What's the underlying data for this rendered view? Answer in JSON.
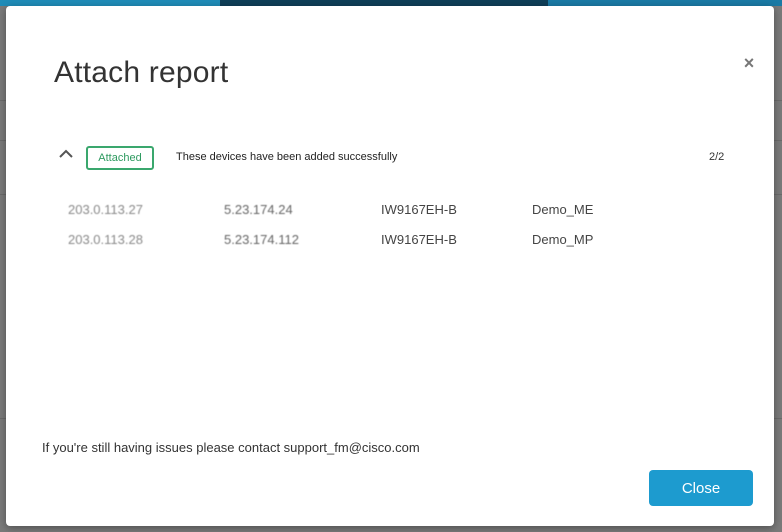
{
  "dialog": {
    "title": "Attach report",
    "close_symbol": "×",
    "status_badge": "Attached",
    "status_message": "These devices have been added successfully",
    "count": "2/2",
    "devices": [
      {
        "ip": "203.0.113.27",
        "address": "5.23.174.24",
        "model": "IW9167EH-B",
        "name": "Demo_ME"
      },
      {
        "ip": "203.0.113.28",
        "address": "5.23.174.112",
        "model": "IW9167EH-B",
        "name": "Demo_MP"
      }
    ],
    "footer_note": "If you're still having issues please contact support_fm@cisco.com",
    "close_button": "Close"
  },
  "colors": {
    "accent": "#1d9bcf",
    "success": "#3aa76d"
  },
  "icons": {
    "close": "close-icon",
    "collapse": "chevron-up-icon"
  }
}
